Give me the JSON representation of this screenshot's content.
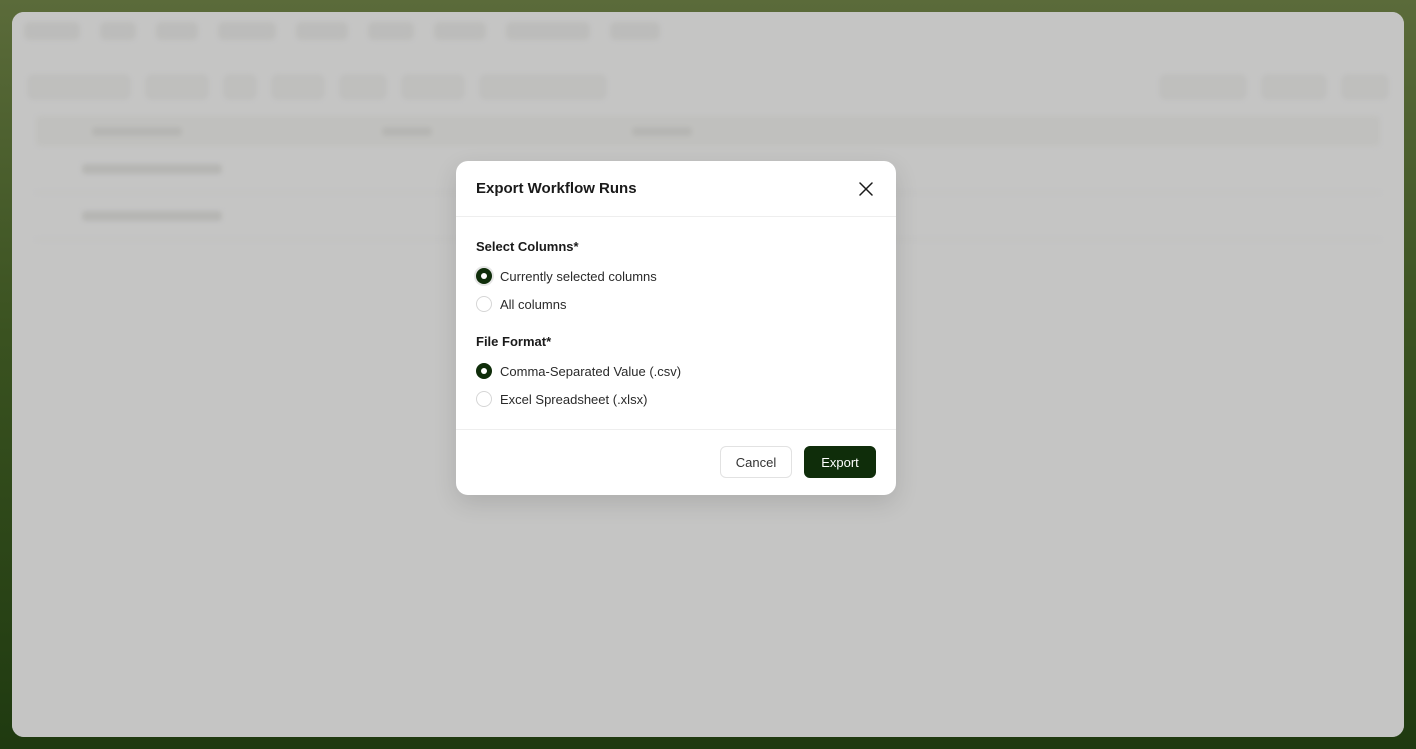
{
  "modal": {
    "title": "Export Workflow Runs",
    "close_icon": "close-icon",
    "columns_group": {
      "label": "Select Columns*",
      "options": [
        {
          "label": "Currently selected columns",
          "checked": true
        },
        {
          "label": "All columns",
          "checked": false
        }
      ]
    },
    "format_group": {
      "label": "File Format*",
      "options": [
        {
          "label": "Comma-Separated Value (.csv)",
          "checked": true
        },
        {
          "label": "Excel Spreadsheet (.xlsx)",
          "checked": false
        }
      ]
    },
    "cancel_label": "Cancel",
    "export_label": "Export"
  },
  "colors": {
    "accent": "#0f2d0a",
    "overlay": "#aaaaaa",
    "frame_top": "#5b6b3a",
    "frame_bottom": "#1f3a10"
  }
}
